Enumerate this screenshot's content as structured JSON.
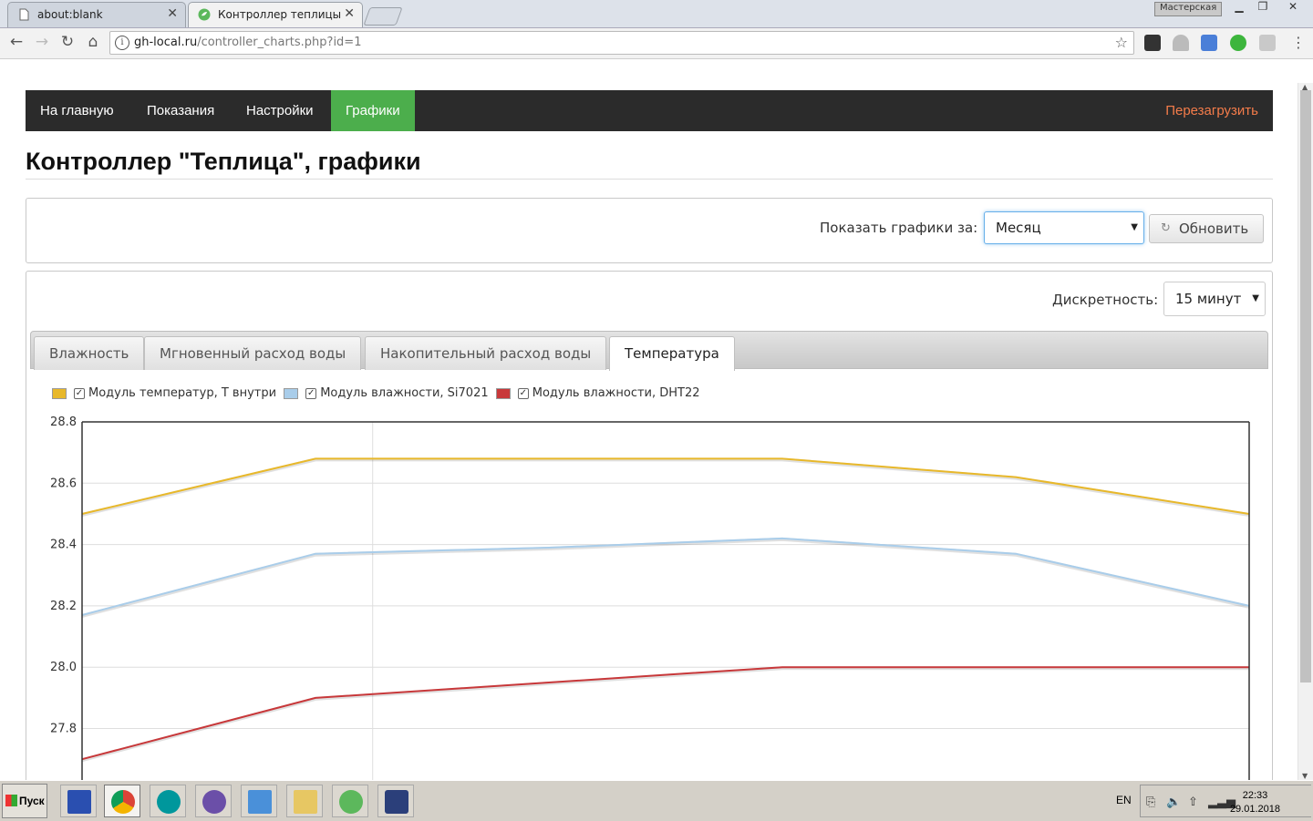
{
  "browser": {
    "tabs": [
      {
        "label": "about:blank",
        "active": false
      },
      {
        "label": "Контроллер теплицы",
        "active": true
      }
    ],
    "profile": "Мастерская",
    "url_host": "gh-local.ru",
    "url_path": "/controller_charts.php?id=1"
  },
  "nav": {
    "items": [
      "На главную",
      "Показания",
      "Настройки",
      "Графики"
    ],
    "active_index": 3,
    "reboot": "Перезагрузить"
  },
  "page": {
    "title": "Контроллер \"Теплица\", графики"
  },
  "controls": {
    "period_label": "Показать графики за:",
    "period_value": "Месяц",
    "refresh": "Обновить",
    "discretion_label": "Дискретность:",
    "discretion_value": "15 минут"
  },
  "tabs": {
    "items": [
      "Влажность",
      "Мгновенный расход воды",
      "Накопительный расход воды",
      "Температура"
    ],
    "active_index": 3
  },
  "chart_data": {
    "type": "line",
    "y_ticks": [
      "28.8",
      "28.6",
      "28.4",
      "28.2",
      "28.0",
      "27.8"
    ],
    "ylim": [
      27.64,
      28.8
    ],
    "x": [
      0,
      1,
      2,
      3,
      4,
      5
    ],
    "grid": true,
    "legend": "top-left",
    "series": [
      {
        "name": "Модуль температур, Т внутри",
        "color": "#e8b82a",
        "values": [
          28.5,
          28.68,
          28.68,
          28.68,
          28.62,
          28.5
        ]
      },
      {
        "name": "Модуль влажности, Si7021",
        "color": "#a9cdea",
        "values": [
          28.17,
          28.37,
          28.39,
          28.42,
          28.37,
          28.2
        ]
      },
      {
        "name": "Модуль влажности, DHT22",
        "color": "#c8383a",
        "values": [
          27.7,
          27.9,
          27.95,
          28.0,
          28.0,
          28.0
        ]
      }
    ]
  },
  "taskbar": {
    "start": "Пуск",
    "lang": "EN",
    "time": "22:33",
    "date": "29.01.2018"
  },
  "colors": {
    "nav_bg": "#2b2b2b",
    "nav_active": "#4cae4c",
    "reboot": "#f47c4a"
  }
}
